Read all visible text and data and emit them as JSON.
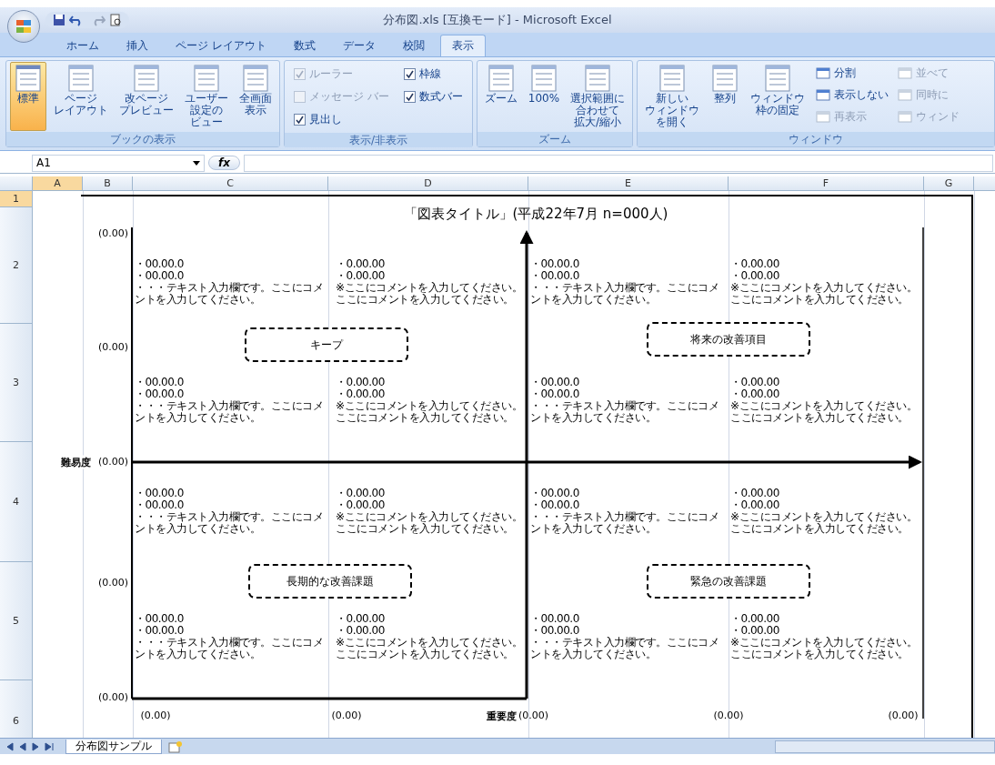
{
  "window": {
    "title": "分布図.xls [互換モード] - Microsoft Excel"
  },
  "ribbon_tabs": [
    {
      "label": "ホーム",
      "selected": false
    },
    {
      "label": "挿入",
      "selected": false
    },
    {
      "label": "ページ レイアウト",
      "selected": false
    },
    {
      "label": "数式",
      "selected": false
    },
    {
      "label": "データ",
      "selected": false
    },
    {
      "label": "校閲",
      "selected": false
    },
    {
      "label": "表示",
      "selected": true
    }
  ],
  "ribbon_groups": [
    {
      "label": "ブックの表示",
      "items": [
        {
          "kind": "large",
          "lines": [
            "標準"
          ],
          "selected": true
        },
        {
          "kind": "large",
          "lines": [
            "ページ",
            "レイアウト"
          ],
          "selected": false
        },
        {
          "kind": "large",
          "lines": [
            "改ページ",
            "プレビュー"
          ],
          "selected": false
        },
        {
          "kind": "large",
          "lines": [
            "ユーザー",
            "設定の",
            "ビュー"
          ],
          "selected": false
        },
        {
          "kind": "large",
          "lines": [
            "全画面",
            "表示"
          ],
          "selected": false
        }
      ]
    },
    {
      "label": "表示/非表示",
      "items": [
        {
          "kind": "check",
          "label": "ルーラー",
          "checked": true,
          "disabled": true
        },
        {
          "kind": "check",
          "label": "枠線",
          "checked": true,
          "disabled": false
        },
        {
          "kind": "check",
          "label": "メッセージ バー",
          "checked": false,
          "disabled": true
        },
        {
          "kind": "check",
          "label": "数式バー",
          "checked": true,
          "disabled": false
        },
        {
          "kind": "check",
          "label": "見出し",
          "checked": true,
          "disabled": false
        }
      ]
    },
    {
      "label": "ズーム",
      "items": [
        {
          "kind": "large",
          "lines": [
            "ズーム"
          ],
          "selected": false
        },
        {
          "kind": "large",
          "lines": [
            "100%"
          ],
          "selected": false
        },
        {
          "kind": "large",
          "lines": [
            "選択範囲に",
            "合わせて",
            "拡大/縮小"
          ],
          "selected": false
        }
      ]
    },
    {
      "label": "ウィンドウ",
      "items": [
        {
          "kind": "large",
          "lines": [
            "新しい",
            "ウィンドウ",
            "を開く"
          ],
          "selected": false
        },
        {
          "kind": "large",
          "lines": [
            "整列"
          ],
          "selected": false
        },
        {
          "kind": "large",
          "lines": [
            "ウィンドウ",
            "枠の固定"
          ],
          "selected": false
        },
        {
          "kind": "small",
          "label": "分割",
          "disabled": false
        },
        {
          "kind": "small",
          "label": "表示しない",
          "disabled": false
        },
        {
          "kind": "small",
          "label": "再表示",
          "disabled": true
        },
        {
          "kind": "small",
          "label": "並べて",
          "disabled": true
        },
        {
          "kind": "small",
          "label": "同時に",
          "disabled": true
        },
        {
          "kind": "small",
          "label": "ウィンド",
          "disabled": true
        }
      ]
    }
  ],
  "formula_bar": {
    "name_box": "A1",
    "fx": "fx"
  },
  "columns": [
    "A",
    "B",
    "C",
    "D",
    "E",
    "F",
    "G"
  ],
  "rows": [
    "1",
    "2",
    "3",
    "4",
    "5",
    "6"
  ],
  "chart": {
    "title": "「図表タイトル」(平成22年7月 n=000人)",
    "y_axis_name": "難易度",
    "x_axis_name": "重要度",
    "y_labels": [
      "(0.00)",
      "(0.00)",
      "(0.00)",
      "(0.00)",
      "(0.00)"
    ],
    "x_labels": [
      "(0.00)",
      "(0.00)",
      "(0.00)",
      "(0.00)",
      "(0.00)"
    ],
    "quadrants": [
      {
        "label": "キープ",
        "notes": [
          [
            "・00.00.0",
            "・00.00.0",
            "・・・テキスト入力欄です。ここにコメ",
            "ントを入力してください。"
          ],
          [
            "・0.00.00",
            "・0.00.00",
            "※ここにコメントを入力してください。",
            "ここにコメントを入力してください。"
          ],
          [
            "・00.00.0",
            "・00.00.0",
            "・・・テキスト入力欄です。ここにコメ",
            "ントを入力してください。"
          ],
          [
            "・0.00.00",
            "・0.00.00",
            "※ここにコメントを入力してください。",
            "ここにコメントを入力してください。"
          ]
        ]
      },
      {
        "label": "将来の改善項目",
        "notes": [
          [
            "・00.00.0",
            "・00.00.0",
            "・・・テキスト入力欄です。ここにコメ",
            "ントを入力してください。"
          ],
          [
            "・0.00.00",
            "・0.00.00",
            "※ここにコメントを入力してください。",
            "ここにコメントを入力してください。"
          ],
          [
            "・00.00.0",
            "・00.00.0",
            "・・・テキスト入力欄です。ここにコメ",
            "ントを入力してください。"
          ],
          [
            "・0.00.00",
            "・0.00.00",
            "※ここにコメントを入力してください。",
            "ここにコメントを入力してください。"
          ]
        ]
      },
      {
        "label": "長期的な改善課題",
        "notes": [
          [
            "・00.00.0",
            "・00.00.0",
            "・・・テキスト入力欄です。ここにコメ",
            "ントを入力してください。"
          ],
          [
            "・0.00.00",
            "・0.00.00",
            "※ここにコメントを入力してください。",
            "ここにコメントを入力してください。"
          ],
          [
            "・00.00.0",
            "・00.00.0",
            "・・・テキスト入力欄です。ここにコメ",
            "ントを入力してください。"
          ],
          [
            "・0.00.00",
            "・0.00.00",
            "※ここにコメントを入力してください。",
            "ここにコメントを入力してください。"
          ]
        ]
      },
      {
        "label": "緊急の改善課題",
        "notes": [
          [
            "・00.00.0",
            "・00.00.0",
            "・・・テキスト入力欄です。ここにコメ",
            "ントを入力してください。"
          ],
          [
            "・0.00.00",
            "・0.00.00",
            "※ここにコメントを入力してください。",
            "ここにコメントを入力してください。"
          ],
          [
            "・00.00.0",
            "・00.00.0",
            "・・・テキスト入力欄です。ここにコメ",
            "ントを入力してください。"
          ],
          [
            "・0.00.00",
            "・0.00.00",
            "※ここにコメントを入力してください。",
            "ここにコメントを入力してください。"
          ]
        ]
      }
    ]
  },
  "sheet_tabs": [
    {
      "label": "分布図サンプル",
      "selected": true
    }
  ]
}
